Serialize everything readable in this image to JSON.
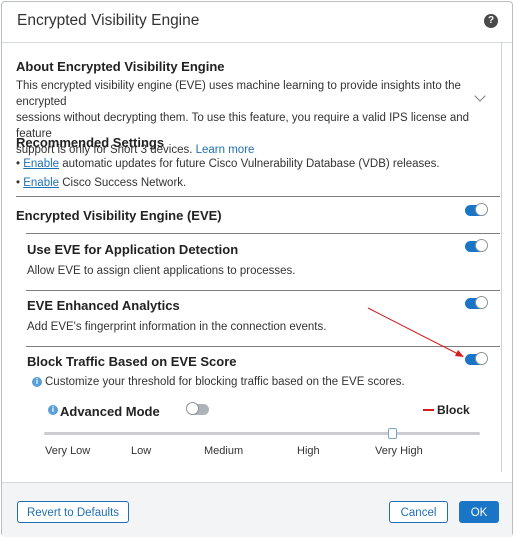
{
  "dialog": {
    "title": "Encrypted Visibility Engine"
  },
  "about": {
    "heading": "About Encrypted Visibility Engine",
    "line1": "This encrypted visibility engine (EVE) uses machine learning to provide insights into the encrypted",
    "line2": "sessions without decrypting them. To use this feature, you require a valid IPS license and feature",
    "line3": "support is only for Snort 3 devices.",
    "learn_more": "Learn more"
  },
  "recommended": {
    "heading": "Recommended Settings",
    "items": [
      {
        "bullet": "•",
        "link": "Enable",
        "text": " automatic updates for future Cisco Vulnerability Database (VDB) releases."
      },
      {
        "bullet": "•",
        "link": "Enable",
        "text": " Cisco Success Network."
      }
    ]
  },
  "eve": {
    "heading": "Encrypted Visibility Engine (EVE)",
    "enabled": true
  },
  "app_detection": {
    "heading": "Use EVE for Application Detection",
    "desc": "Allow EVE to assign client applications to processes.",
    "enabled": true
  },
  "analytics": {
    "heading": "EVE Enhanced Analytics",
    "desc": "Add EVE's fingerprint information in the connection events.",
    "enabled": true
  },
  "block": {
    "heading": "Block Traffic Based on EVE Score",
    "desc": "Customize your threshold for blocking traffic based on the EVE scores.",
    "enabled": true,
    "advanced_mode_label": "Advanced Mode",
    "advanced_mode": false,
    "legend_label": "Block",
    "slider_position": 0.8,
    "ticks": [
      "Very Low",
      "Low",
      "Medium",
      "High",
      "Very High"
    ]
  },
  "footer": {
    "revert_label": "Revert to Defaults",
    "cancel_label": "Cancel",
    "ok_label": "OK"
  },
  "colors": {
    "accent": "#1a75c6",
    "block_red": "#d81b1b",
    "link": "#1f6fb5"
  },
  "icons": {
    "help": "question-circle-icon",
    "info": "info-circle-icon",
    "chevron": "chevron-down-icon"
  }
}
